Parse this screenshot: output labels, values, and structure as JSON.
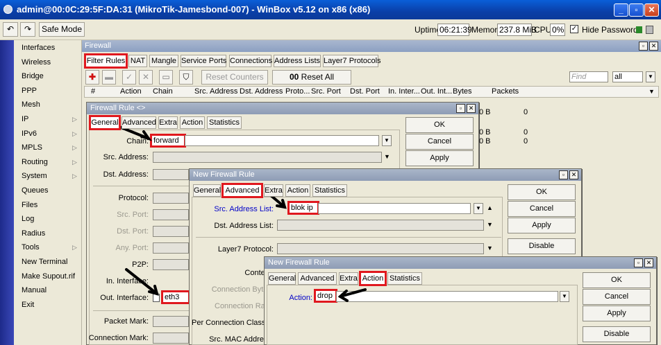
{
  "window": {
    "title": "admin@00:0C:29:5F:DA:31 (MikroTik-Jamesbond-007) - WinBox v5.12 on x86 (x86)"
  },
  "toolbar": {
    "safe_mode": "Safe Mode",
    "uptime_label": "Uptime:",
    "uptime": "06:21:39",
    "memory_label": "Memory:",
    "memory": "237.8 MiB",
    "cpu_label": "CPU:",
    "cpu": "0%",
    "hide_passwords": "Hide Passwords"
  },
  "sidebar": {
    "items": [
      "Interfaces",
      "Wireless",
      "Bridge",
      "PPP",
      "Mesh",
      "IP",
      "IPv6",
      "MPLS",
      "Routing",
      "System",
      "Queues",
      "Files",
      "Log",
      "Radius",
      "Tools",
      "New Terminal",
      "Make Supout.rif",
      "Manual",
      "Exit"
    ]
  },
  "firewall": {
    "title": "Firewall",
    "tabs": [
      "Filter Rules",
      "NAT",
      "Mangle",
      "Service Ports",
      "Connections",
      "Address Lists",
      "Layer7 Protocols"
    ],
    "reset_counters": "Reset Counters",
    "reset_all_counters": "Reset All Counters",
    "find_placeholder": "Find",
    "filter_value": "all",
    "columns": [
      "#",
      "Action",
      "Chain",
      "Src. Address",
      "Dst. Address",
      "Proto...",
      "Src. Port",
      "Dst. Port",
      "In. Inter...",
      "Out. Int...",
      "Bytes",
      "Packets"
    ],
    "rows": [
      {
        "bytes": "0 B",
        "packets": "0"
      },
      {
        "bytes": "0 B",
        "packets": "0"
      },
      {
        "bytes": "0 B",
        "packets": "0"
      }
    ]
  },
  "dialog1": {
    "title": "Firewall Rule <>",
    "tabs": [
      "General",
      "Advanced",
      "Extra",
      "Action",
      "Statistics"
    ],
    "chain_label": "Chain:",
    "chain_value": "forward",
    "src_address_label": "Src. Address:",
    "dst_address_label": "Dst. Address:",
    "protocol_label": "Protocol:",
    "src_port_label": "Src. Port:",
    "dst_port_label": "Dst. Port:",
    "any_port_label": "Any. Port:",
    "p2p_label": "P2P:",
    "in_interface_label": "In. Interface:",
    "out_interface_label": "Out. Interface:",
    "out_interface_value": "eth3",
    "packet_mark_label": "Packet Mark:",
    "connection_mark_label": "Connection Mark:",
    "buttons": [
      "OK",
      "Cancel",
      "Apply"
    ]
  },
  "dialog2": {
    "title": "New Firewall Rule",
    "tabs": [
      "General",
      "Advanced",
      "Extra",
      "Action",
      "Statistics"
    ],
    "src_list_label": "Src. Address List:",
    "src_list_value": "blok ip",
    "dst_list_label": "Dst. Address List:",
    "layer7_label": "Layer7 Protocol:",
    "content_label": "Content:",
    "conn_bytes_label": "Connection Bytes:",
    "conn_rate_label": "Connection Rate:",
    "per_conn_label": "Per Connection Classifier:",
    "src_mac_label": "Src. MAC Address:",
    "buttons": [
      "OK",
      "Cancel",
      "Apply",
      "Disable"
    ]
  },
  "dialog3": {
    "title": "New Firewall Rule",
    "tabs": [
      "General",
      "Advanced",
      "Extra",
      "Action",
      "Statistics"
    ],
    "action_label": "Action:",
    "action_value": "drop",
    "buttons": [
      "OK",
      "Cancel",
      "Apply",
      "Disable"
    ]
  }
}
